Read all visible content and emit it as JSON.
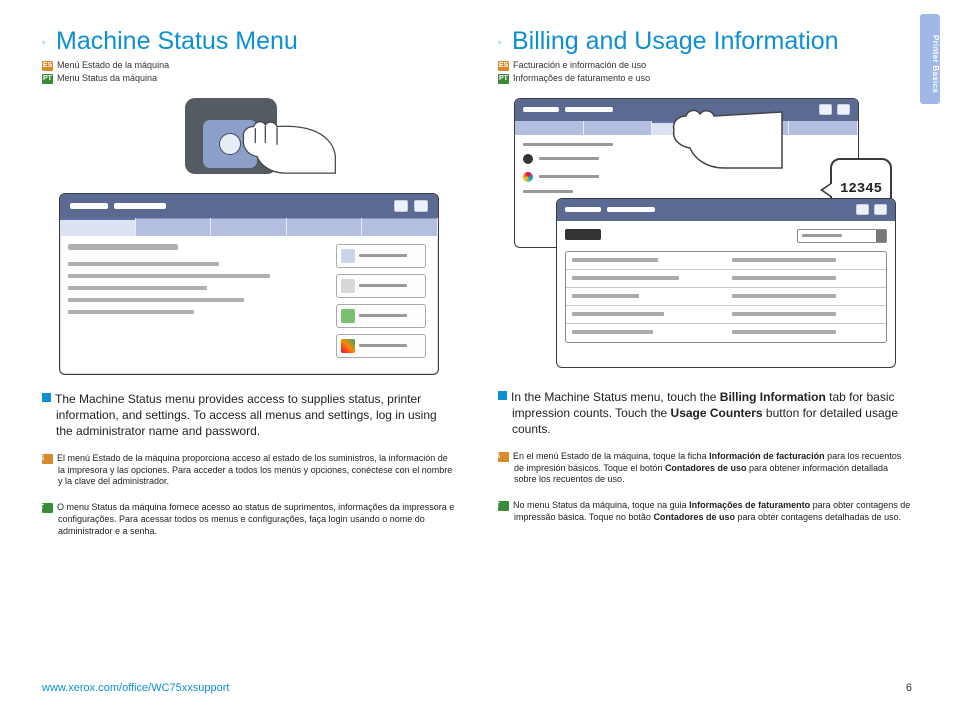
{
  "sideTab": "Printer Basics",
  "left": {
    "title": "Machine Status Menu",
    "sub_es": "Menú Estado de la máquina",
    "sub_pt": "Menu Status da máquina",
    "body_en": "The Machine Status menu provides access to supplies status, printer information, and settings. To access all menus and settings, log in using the administrator name and password.",
    "body_es": "El menú Estado de la máquina proporciona acceso al estado de los suministros, la información de la impresora y las opciones. Para acceder a todos los menús y opciones, conéctese con el nombre y la clave del administrador.",
    "body_pt": "O menu Status da máquina fornece acesso ao status de suprimentos, informações da impressora e configurações. Para acessar todos os menus e configurações, faça login usando o nome do administrador e a senha."
  },
  "right": {
    "title": "Billing and Usage Information",
    "sub_es": "Facturación e información de uso",
    "sub_pt": "Informações de faturamento e uso",
    "counter": "12345",
    "body_en_pre": "In the Machine Status menu, touch the ",
    "body_en_b1": "Billing Information",
    "body_en_mid": " tab for basic impression counts. Touch the ",
    "body_en_b2": "Usage Counters",
    "body_en_post": " button for detailed usage counts.",
    "body_es_pre": "En el menú Estado de la máquina, toque la ficha ",
    "body_es_b1": "Información de facturación",
    "body_es_mid": " para los recuentos de impresión básicos. Toque el botón ",
    "body_es_b2": "Contadores de uso",
    "body_es_post": " para obtener información detallada sobre los recuentos de uso.",
    "body_pt_pre": "No menu Status da máquina, toque na guia ",
    "body_pt_b1": "Informações de faturamento",
    "body_pt_mid": " para obter contagens de impressão básica. Toque no botão ",
    "body_pt_b2": "Contadores de uso",
    "body_pt_post": " para obter contagens detalhadas de uso."
  },
  "footer": {
    "url": "www.xerox.com/office/WC75xxsupport",
    "page": "6"
  }
}
